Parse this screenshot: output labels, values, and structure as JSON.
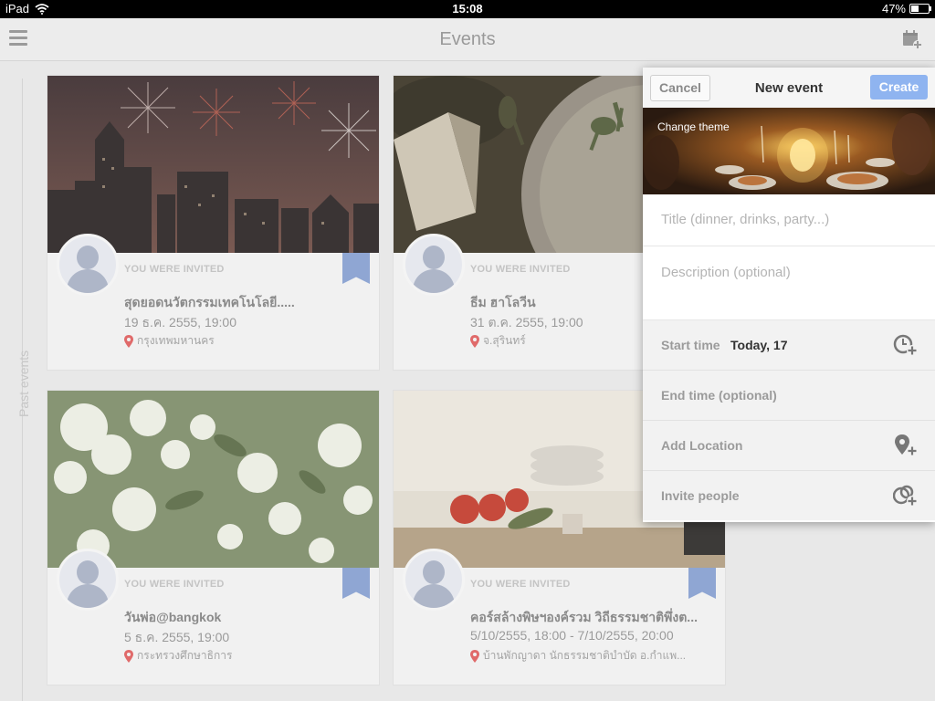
{
  "statusbar": {
    "device": "iPad",
    "time": "15:08",
    "battery": "47%",
    "battery_level": 0.47
  },
  "navbar": {
    "title": "Events"
  },
  "sidebar": {
    "past_events_label": "Past events"
  },
  "cards": [
    {
      "invited": "YOU WERE INVITED",
      "title": "สุดยอดนวัตกรรมเทคโนโลยี.....",
      "date": "19 ธ.ค. 2555, 19:00",
      "location": "กรุงเทพมหานคร",
      "bookmarked": true
    },
    {
      "invited": "YOU WERE INVITED",
      "title": "ธีม ฮาโลวีน",
      "date": "31 ต.ค. 2555, 19:00",
      "location": "จ.สุรินทร์",
      "bookmarked": false
    },
    {
      "invited": "YOU WERE INVITED",
      "title": "วันพ่อ@bangkok",
      "date": "5 ธ.ค. 2555, 19:00",
      "location": "กระทรวงศึกษาธิการ",
      "bookmarked": true
    },
    {
      "invited": "YOU WERE INVITED",
      "title": "คอร์สล้างพิษฯองค์รวม วิถีธรรมชาติพึ่งต...",
      "date": "5/10/2555, 18:00 - 7/10/2555, 20:00",
      "location": "บ้านพักญาดา  นักธรรมชาติบำบัด อ.กำแพ...",
      "bookmarked": true
    }
  ],
  "new_event": {
    "title": "New event",
    "cancel": "Cancel",
    "create": "Create",
    "change_theme": "Change theme",
    "title_placeholder": "Title (dinner, drinks, party...)",
    "description_placeholder": "Description (optional)",
    "start_label": "Start time",
    "start_value": "Today, 17",
    "end_label": "End time (optional)",
    "location_label": "Add Location",
    "invite_label": "Invite people"
  },
  "colors": {
    "accent": "#8fb4f0",
    "ribbon": "#8fa6d3",
    "pin": "#e06a6a"
  },
  "icons": [
    "wifi-icon",
    "menu-icon",
    "add-calendar-icon",
    "location-pin-icon",
    "clock-add-icon",
    "location-add-icon",
    "people-add-icon",
    "bookmark-ribbon-icon",
    "avatar-placeholder-icon"
  ]
}
